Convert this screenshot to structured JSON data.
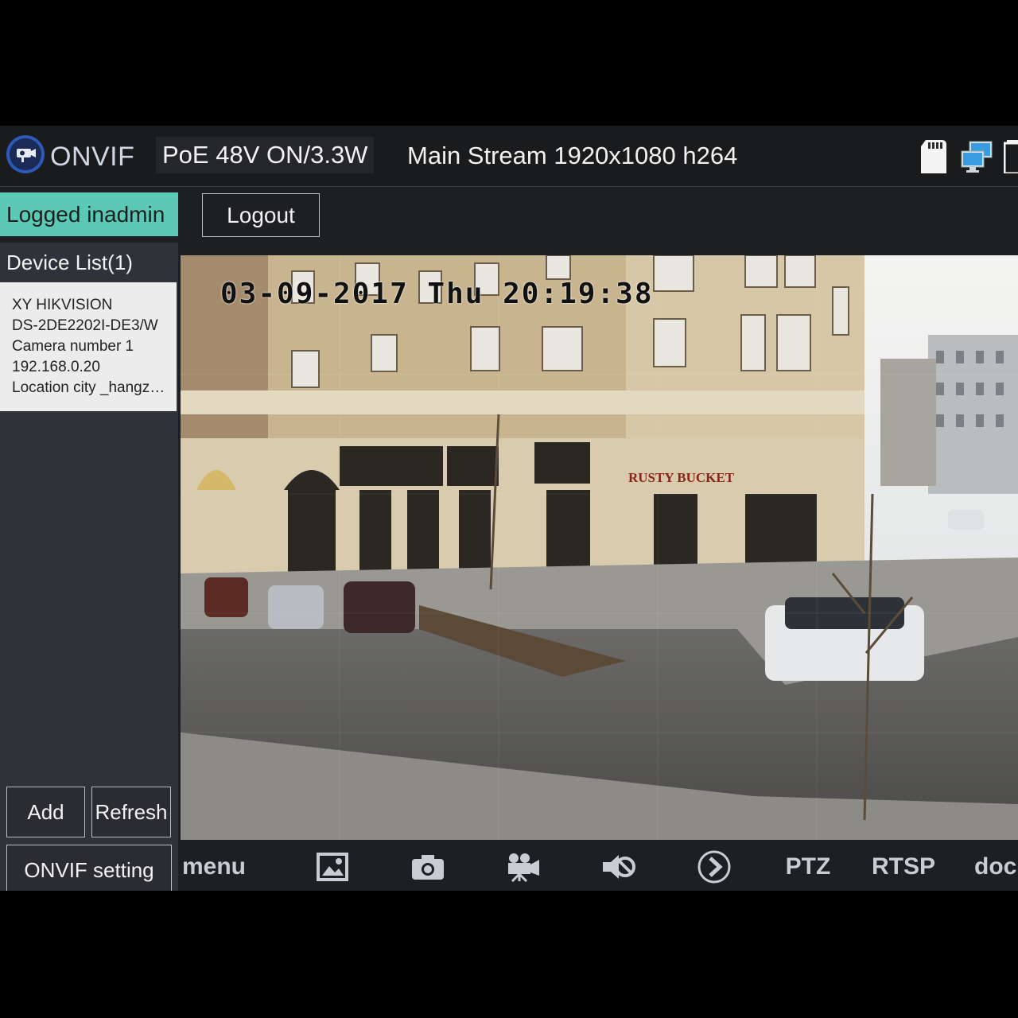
{
  "topbar": {
    "app_name": "ONVIF",
    "poe_status": "PoE 48V ON/3.3W",
    "stream_info": "Main Stream 1920x1080 h264",
    "icons": [
      "camera-logo-icon",
      "sd-card-icon",
      "network-icon",
      "battery-icon"
    ]
  },
  "session": {
    "logged_label": "Logged inadmin",
    "logout_label": "Logout"
  },
  "sidebar": {
    "device_list_title": "Device List(1)",
    "device": {
      "line1": "XY HIKVISION",
      "line2": "DS-2DE2202I-DE3/W",
      "line3": "Camera number  1",
      "line4": "192.168.0.20",
      "line5": "Location  city _hangzhou"
    },
    "add_label": "Add",
    "refresh_label": "Refresh",
    "onvif_setting_label": "ONVIF setting"
  },
  "video": {
    "osd_timestamp": "03-09-2017 Thu 20:19:38",
    "sign_text": "RUSTY BUCKET"
  },
  "toolbar": {
    "menu_label": "menu",
    "ptz_label": "PTZ",
    "rtsp_label": "RTSP",
    "doc_label": "doc",
    "icons": [
      "image-icon",
      "camera-icon",
      "video-camera-icon",
      "mute-icon",
      "play-circle-icon"
    ]
  },
  "colors": {
    "accent": "#5cc8b6",
    "background": "#1d1f22",
    "sidebar": "#2f3238"
  }
}
